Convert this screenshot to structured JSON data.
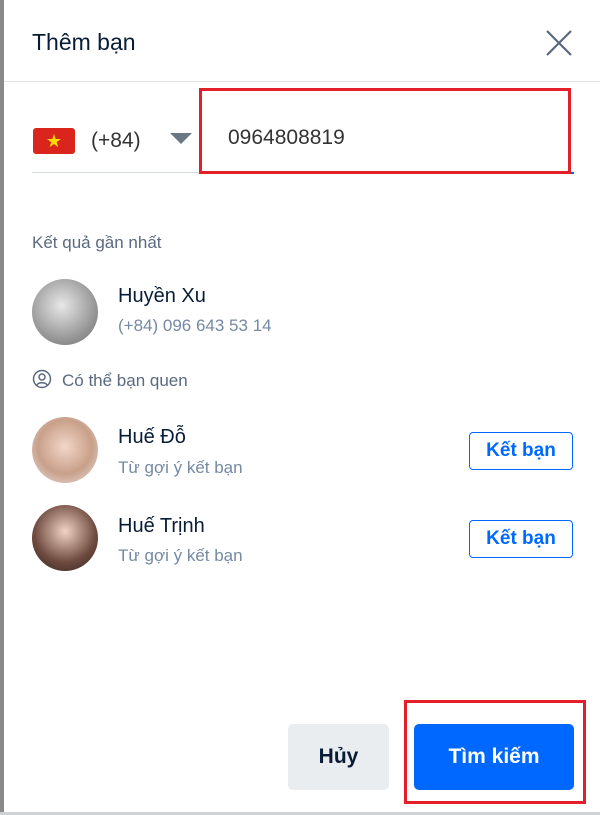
{
  "dialog": {
    "title": "Thêm bạn",
    "close_icon": "close-icon"
  },
  "phone_input": {
    "country_flag": "vietnam-flag",
    "country_code": "(+84)",
    "value": "0964808819"
  },
  "recent": {
    "heading": "Kết quả gần nhất",
    "items": [
      {
        "name": "Huyền Xu",
        "phone": "(+84) 096 643 53 14"
      }
    ]
  },
  "suggestions": {
    "heading": "Có thể bạn quen",
    "icon": "user-circle-icon",
    "items": [
      {
        "name": "Huế Đỗ",
        "source": "Từ gợi ý kết bạn",
        "action": "Kết bạn"
      },
      {
        "name": "Huế Trịnh",
        "source": "Từ gợi ý kết bạn",
        "action": "Kết bạn"
      }
    ]
  },
  "footer": {
    "cancel": "Hủy",
    "search": "Tìm kiếm"
  },
  "colors": {
    "accent": "#0068ff",
    "highlight": "#e3202a"
  }
}
